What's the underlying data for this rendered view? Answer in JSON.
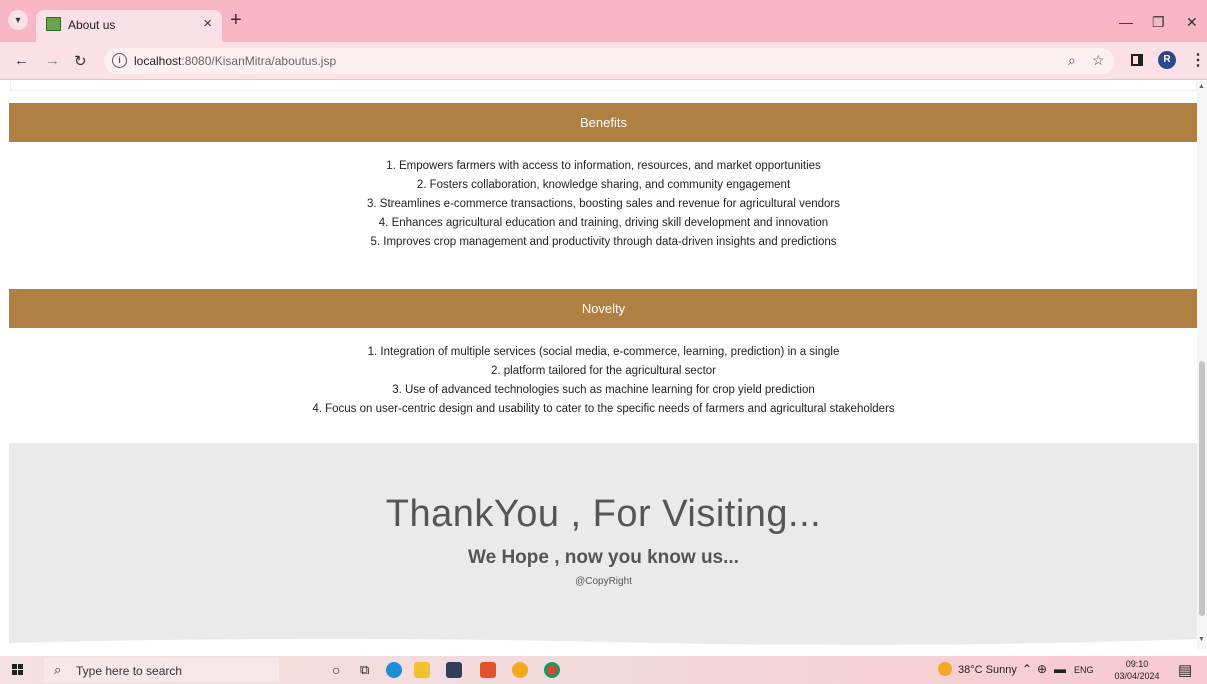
{
  "browser": {
    "tab_title": "About us",
    "url_host": "localhost",
    "url_path": ":8080/KisanMitra/aboutus.jsp",
    "profile_initial": "R"
  },
  "page": {
    "benefits": {
      "heading": "Benefits",
      "items": [
        "1. Empowers farmers with access to information, resources, and market opportunities",
        "2. Fosters collaboration, knowledge sharing, and community engagement",
        "3. Streamlines e-commerce transactions, boosting sales and revenue for agricultural vendors",
        "4. Enhances agricultural education and training, driving skill development and innovation",
        "5. Improves crop management and productivity through data-driven insights and predictions"
      ]
    },
    "novelty": {
      "heading": "Novelty",
      "items": [
        "1. Integration of multiple services (social media, e-commerce, learning, prediction) in a single",
        "2. platform tailored for the agricultural sector",
        "3. Use of advanced technologies such as machine learning for crop yield prediction",
        "4. Focus on user-centric design and usability to cater to the specific needs of farmers and agricultural stakeholders"
      ]
    },
    "footer": {
      "title": "ThankYou , For Visiting...",
      "subtitle": "We Hope , now you know us...",
      "copyright": "@CopyRight"
    }
  },
  "taskbar": {
    "search_placeholder": "Type here to search",
    "weather": "38°C  Sunny",
    "language": "ENG",
    "time": "09:10",
    "date": "03/04/2024"
  },
  "colors": {
    "section_header": "#b08042",
    "browser_frame": "#f9b6c6",
    "footer_bg": "#eaeaea"
  }
}
